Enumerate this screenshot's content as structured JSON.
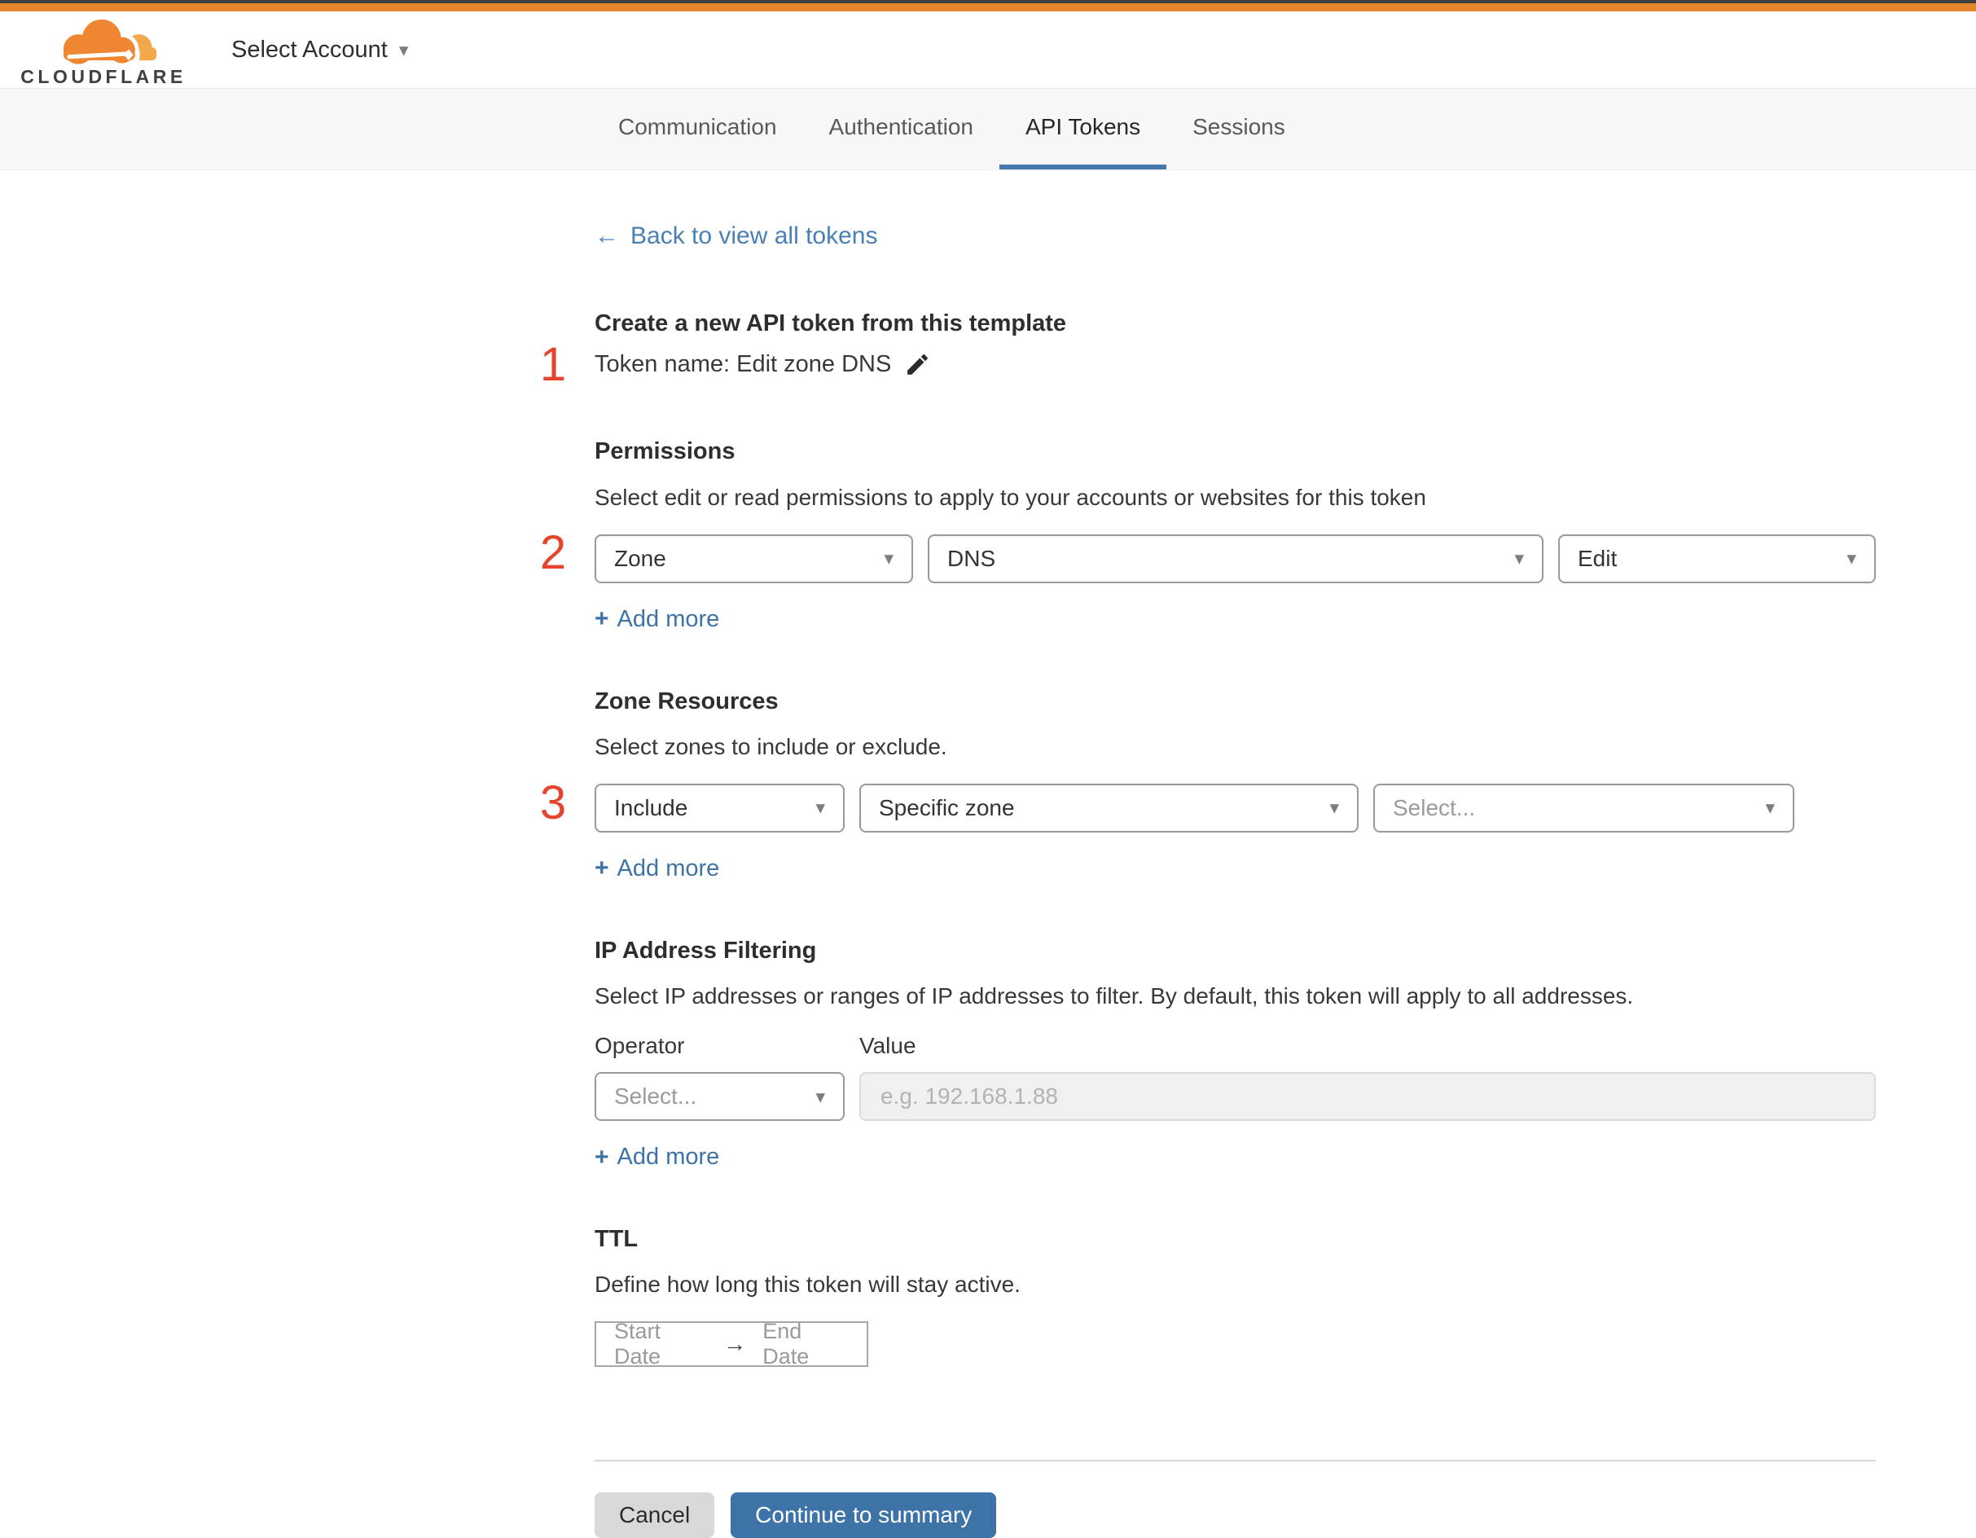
{
  "colors": {
    "top_bar_orange": "#e8862f",
    "top_bar_dark": "#3f3f3f",
    "link_blue": "#4a80b6",
    "button_blue": "#3d73a6",
    "tab_underline_blue": "#4579ab",
    "step_number_red": "#e5452f"
  },
  "icons": {
    "dropdown_caret": "▾",
    "account_caret": "▾",
    "back_arrow": "←",
    "range_arrow": "→",
    "plus": "+",
    "pencil": "✎",
    "cloudflare_logo": "orange-cloud"
  },
  "header": {
    "brand": "CLOUDFLARE",
    "account_selector": "Select Account"
  },
  "nav": {
    "tabs": [
      {
        "label": "Communication",
        "active": false
      },
      {
        "label": "Authentication",
        "active": false
      },
      {
        "label": "API Tokens",
        "active": true
      },
      {
        "label": "Sessions",
        "active": false
      }
    ]
  },
  "back_link": {
    "label": "Back to view all tokens"
  },
  "token_section": {
    "number": "1",
    "title": "Create a new API token from this template",
    "token_name": "Token name: Edit zone DNS"
  },
  "permissions": {
    "number": "2",
    "title": "Permissions",
    "description": "Select edit or read permissions to apply to your accounts or websites for this token",
    "selects": [
      {
        "value": "Zone"
      },
      {
        "value": "DNS"
      },
      {
        "value": "Edit"
      }
    ],
    "add_more": "Add more"
  },
  "zone_resources": {
    "number": "3",
    "title": "Zone Resources",
    "description": "Select zones to include or exclude.",
    "selects": [
      {
        "value": "Include"
      },
      {
        "value": "Specific zone"
      },
      {
        "value": "Select..."
      }
    ],
    "add_more": "Add more"
  },
  "ip_filtering": {
    "title": "IP Address Filtering",
    "description": "Select IP addresses or ranges of IP addresses to filter. By default, this token will apply to all addresses.",
    "operator_label": "Operator",
    "value_label": "Value",
    "operator_value": "Select...",
    "value_placeholder": "e.g. 192.168.1.88",
    "add_more": "Add more"
  },
  "ttl": {
    "title": "TTL",
    "description": "Define how long this token will stay active.",
    "start_date": "Start Date",
    "end_date": "End Date"
  },
  "footer": {
    "cancel": "Cancel",
    "continue": "Continue to summary"
  }
}
